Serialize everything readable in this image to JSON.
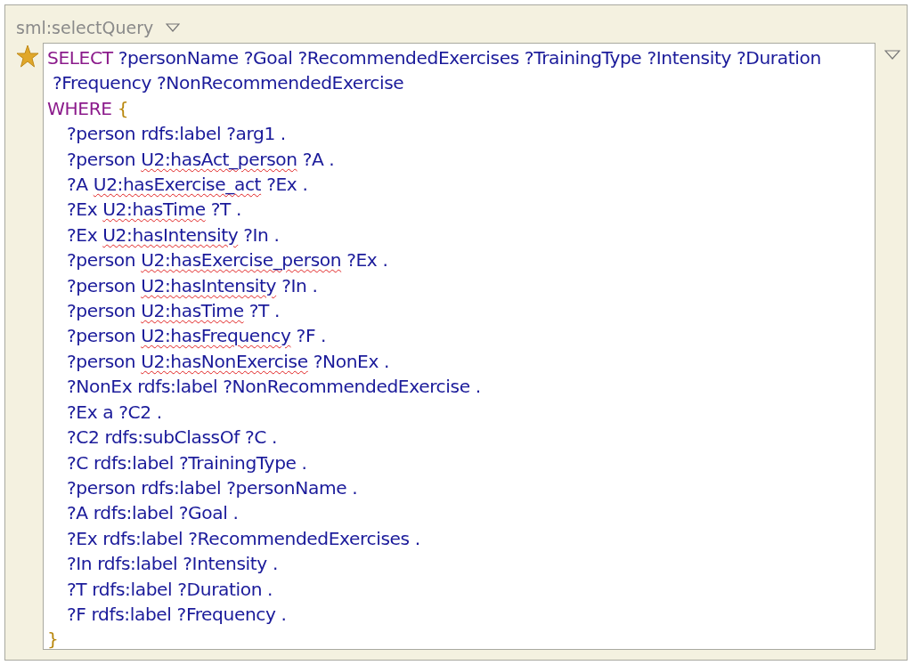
{
  "field": {
    "label": "sml:selectQuery",
    "starred": true
  },
  "lines": [
    {
      "indented": false,
      "segments": [
        {
          "kind": "keyword",
          "text": "SELECT"
        },
        {
          "kind": "plain",
          "text": " ?personName ?Goal ?RecommendedExercises ?TrainingType ?Intensity ?Duration"
        }
      ]
    },
    {
      "indented": false,
      "segments": [
        {
          "kind": "plain",
          "text": " ?Frequency ?NonRecommendedExercise"
        }
      ]
    },
    {
      "indented": false,
      "segments": [
        {
          "kind": "keyword",
          "text": "WHERE "
        },
        {
          "kind": "brace",
          "text": "{"
        }
      ]
    },
    {
      "indented": true,
      "segments": [
        {
          "kind": "plain",
          "text": "?person rdfs:label ?arg1 ."
        }
      ]
    },
    {
      "indented": true,
      "segments": [
        {
          "kind": "plain",
          "text": "?person "
        },
        {
          "kind": "flagged",
          "text": "U2:hasAct_person"
        },
        {
          "kind": "plain",
          "text": " ?A ."
        }
      ]
    },
    {
      "indented": true,
      "segments": [
        {
          "kind": "plain",
          "text": "?A "
        },
        {
          "kind": "flagged",
          "text": "U2:hasExercise_act"
        },
        {
          "kind": "plain",
          "text": " ?Ex ."
        }
      ]
    },
    {
      "indented": true,
      "segments": [
        {
          "kind": "plain",
          "text": "?Ex "
        },
        {
          "kind": "flagged",
          "text": "U2:hasTime"
        },
        {
          "kind": "plain",
          "text": " ?T ."
        }
      ]
    },
    {
      "indented": true,
      "segments": [
        {
          "kind": "plain",
          "text": "?Ex "
        },
        {
          "kind": "flagged",
          "text": "U2:hasIntensity"
        },
        {
          "kind": "plain",
          "text": " ?In ."
        }
      ]
    },
    {
      "indented": true,
      "segments": [
        {
          "kind": "plain",
          "text": "?person "
        },
        {
          "kind": "flagged",
          "text": "U2:hasExercise_person"
        },
        {
          "kind": "plain",
          "text": " ?Ex ."
        }
      ]
    },
    {
      "indented": true,
      "segments": [
        {
          "kind": "plain",
          "text": "?person "
        },
        {
          "kind": "flagged",
          "text": "U2:hasIntensity"
        },
        {
          "kind": "plain",
          "text": " ?In ."
        }
      ]
    },
    {
      "indented": true,
      "segments": [
        {
          "kind": "plain",
          "text": "?person "
        },
        {
          "kind": "flagged",
          "text": "U2:hasTime"
        },
        {
          "kind": "plain",
          "text": " ?T ."
        }
      ]
    },
    {
      "indented": true,
      "segments": [
        {
          "kind": "plain",
          "text": "?person "
        },
        {
          "kind": "flagged",
          "text": "U2:hasFrequency"
        },
        {
          "kind": "plain",
          "text": " ?F ."
        }
      ]
    },
    {
      "indented": true,
      "segments": [
        {
          "kind": "plain",
          "text": "?person "
        },
        {
          "kind": "flagged",
          "text": "U2:hasNonExercise"
        },
        {
          "kind": "plain",
          "text": " ?NonEx ."
        }
      ]
    },
    {
      "indented": true,
      "segments": [
        {
          "kind": "plain",
          "text": "?NonEx rdfs:label ?NonRecommendedExercise ."
        }
      ]
    },
    {
      "indented": true,
      "segments": [
        {
          "kind": "plain",
          "text": "?Ex a ?C2 ."
        }
      ]
    },
    {
      "indented": true,
      "segments": [
        {
          "kind": "plain",
          "text": "?C2 rdfs:subClassOf ?C ."
        }
      ]
    },
    {
      "indented": true,
      "segments": [
        {
          "kind": "plain",
          "text": "?C rdfs:label ?TrainingType ."
        }
      ]
    },
    {
      "indented": true,
      "segments": [
        {
          "kind": "plain",
          "text": "?person rdfs:label ?personName ."
        }
      ]
    },
    {
      "indented": true,
      "segments": [
        {
          "kind": "plain",
          "text": "?A rdfs:label ?Goal ."
        }
      ]
    },
    {
      "indented": true,
      "segments": [
        {
          "kind": "plain",
          "text": "?Ex rdfs:label ?RecommendedExercises ."
        }
      ]
    },
    {
      "indented": true,
      "segments": [
        {
          "kind": "plain",
          "text": "?In rdfs:label ?Intensity ."
        }
      ]
    },
    {
      "indented": true,
      "segments": [
        {
          "kind": "plain",
          "text": "?T rdfs:label ?Duration ."
        }
      ]
    },
    {
      "indented": true,
      "segments": [
        {
          "kind": "plain",
          "text": "?F rdfs:label ?Frequency ."
        }
      ]
    },
    {
      "indented": false,
      "segments": [
        {
          "kind": "brace",
          "text": "}"
        }
      ]
    }
  ]
}
